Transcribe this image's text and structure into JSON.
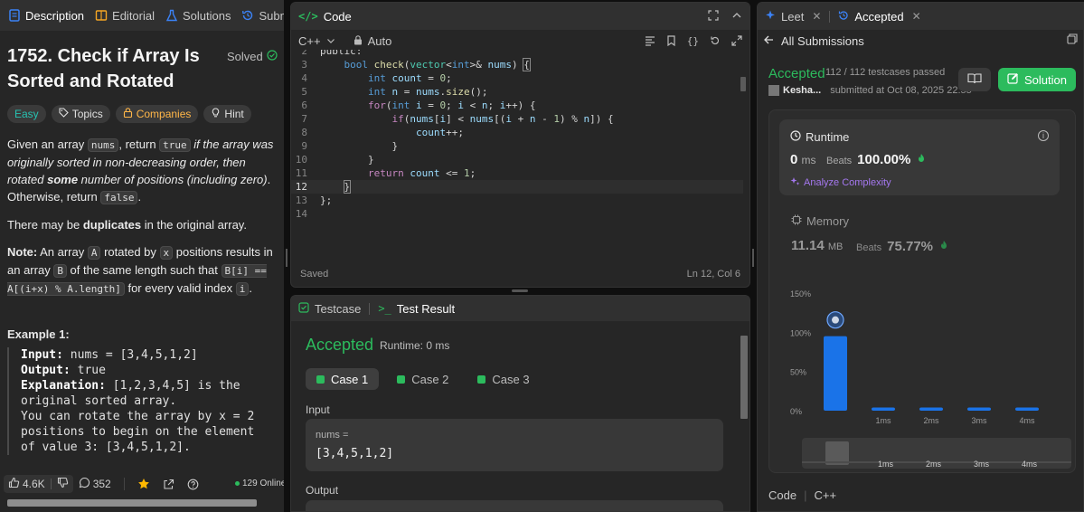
{
  "left": {
    "tabs": [
      {
        "label": "Description",
        "icon": "document-icon"
      },
      {
        "label": "Editorial",
        "icon": "book-icon"
      },
      {
        "label": "Solutions",
        "icon": "flask-icon"
      },
      {
        "label": "Submiss",
        "icon": "history-icon"
      }
    ],
    "title": "1752. Check if Array Is Sorted and Rotated",
    "solved": "Solved",
    "tags": {
      "difficulty": "Easy",
      "topics": "Topics",
      "companies": "Companies",
      "hint": "Hint"
    },
    "desc": {
      "p1_a": "Given an array ",
      "p1_code1": "nums",
      "p1_b": ", return ",
      "p1_code2": "true",
      "p1_c": " if the array was originally sorted in non-decreasing order, then rotated ",
      "p1_some": "some",
      "p1_d": " number of positions (including zero)",
      "p1_e": ". Otherwise, return ",
      "p1_code3": "false",
      "p1_f": ".",
      "p2_a": "There may be ",
      "p2_bold": "duplicates",
      "p2_b": " in the original array.",
      "note_label": "Note:",
      "note_a": " An array ",
      "note_code1": "A",
      "note_b": " rotated by ",
      "note_code2": "x",
      "note_c": " positions results in an array ",
      "note_code3": "B",
      "note_d": " of the same length such that ",
      "note_code4": "B[i] == A[(i+x) % A.length]",
      "note_e": " for every valid index ",
      "note_code5": "i",
      "note_f": "."
    },
    "example": {
      "title": "Example 1:",
      "input_label": "Input:",
      "input_val": " nums = [3,4,5,1,2]",
      "output_label": "Output:",
      "output_val": " true",
      "expl_label": "Explanation:",
      "expl_val": " [1,2,3,4,5] is the original sorted array.",
      "expl_2": "You can rotate the array by x = 2 positions to begin on the element of value 3: [3,4,5,1,2]."
    },
    "footer": {
      "likes": "4.6K",
      "comments": "352",
      "online": "129 Online"
    }
  },
  "code": {
    "title": "Code",
    "language": "C++",
    "mode": "Auto",
    "status": "Saved",
    "position": "Ln 12, Col 6",
    "lines": [
      {
        "n": "2",
        "text": "public:"
      },
      {
        "n": "3",
        "text": "    bool check(vector<int>& nums) {"
      },
      {
        "n": "4",
        "text": "        int count = 0;"
      },
      {
        "n": "5",
        "text": "        int n = nums.size();"
      },
      {
        "n": "6",
        "text": "        for(int i = 0; i < n; i++) {"
      },
      {
        "n": "7",
        "text": "            if(nums[i] < nums[(i + n - 1) % n]) {"
      },
      {
        "n": "8",
        "text": "                count++;"
      },
      {
        "n": "9",
        "text": "            }"
      },
      {
        "n": "10",
        "text": "        }"
      },
      {
        "n": "11",
        "text": "        return count <= 1;"
      },
      {
        "n": "12",
        "text": "    }"
      },
      {
        "n": "13",
        "text": "};"
      },
      {
        "n": "14",
        "text": ""
      }
    ]
  },
  "test": {
    "tab_testcase": "Testcase",
    "tab_result": "Test Result",
    "status": "Accepted",
    "runtime": "Runtime: 0 ms",
    "cases": [
      "Case 1",
      "Case 2",
      "Case 3"
    ],
    "input_label": "Input",
    "input_var": "nums =",
    "input_value": "[3,4,5,1,2]",
    "output_label": "Output"
  },
  "right": {
    "tab_leet": "Leet",
    "tab_accepted": "Accepted",
    "back_label": "All Submissions",
    "status": "Accepted",
    "passed": "112 / 112 testcases passed",
    "user": "Kesha...",
    "submitted_at": "submitted at Oct 08, 2025 22:55",
    "solution_btn": "Solution",
    "runtime": {
      "title": "Runtime",
      "value": "0",
      "unit": "ms",
      "beats_label": "Beats",
      "beats": "100.00%",
      "analyze": "Analyze Complexity"
    },
    "memory": {
      "title": "Memory",
      "value": "11.14",
      "unit": "MB",
      "beats_label": "Beats",
      "beats": "75.77%"
    },
    "footer": {
      "code": "Code",
      "lang": "C++"
    }
  },
  "chart_data": {
    "type": "bar",
    "categories": [
      "",
      "1ms",
      "2ms",
      "3ms",
      "4ms"
    ],
    "values": [
      95,
      4,
      4,
      4,
      4
    ],
    "ylabel": "",
    "yticks": [
      "150%",
      "100%",
      "50%",
      "0%"
    ],
    "ylim": [
      0,
      150
    ],
    "highlight_index": 0,
    "bar_color": "#1a73e8",
    "mini_categories": [
      "1ms",
      "2ms",
      "3ms",
      "4ms"
    ]
  },
  "colors": {
    "accent_green": "#2cbb5d",
    "bar_blue": "#1a73e8",
    "purple": "#a578f0"
  }
}
